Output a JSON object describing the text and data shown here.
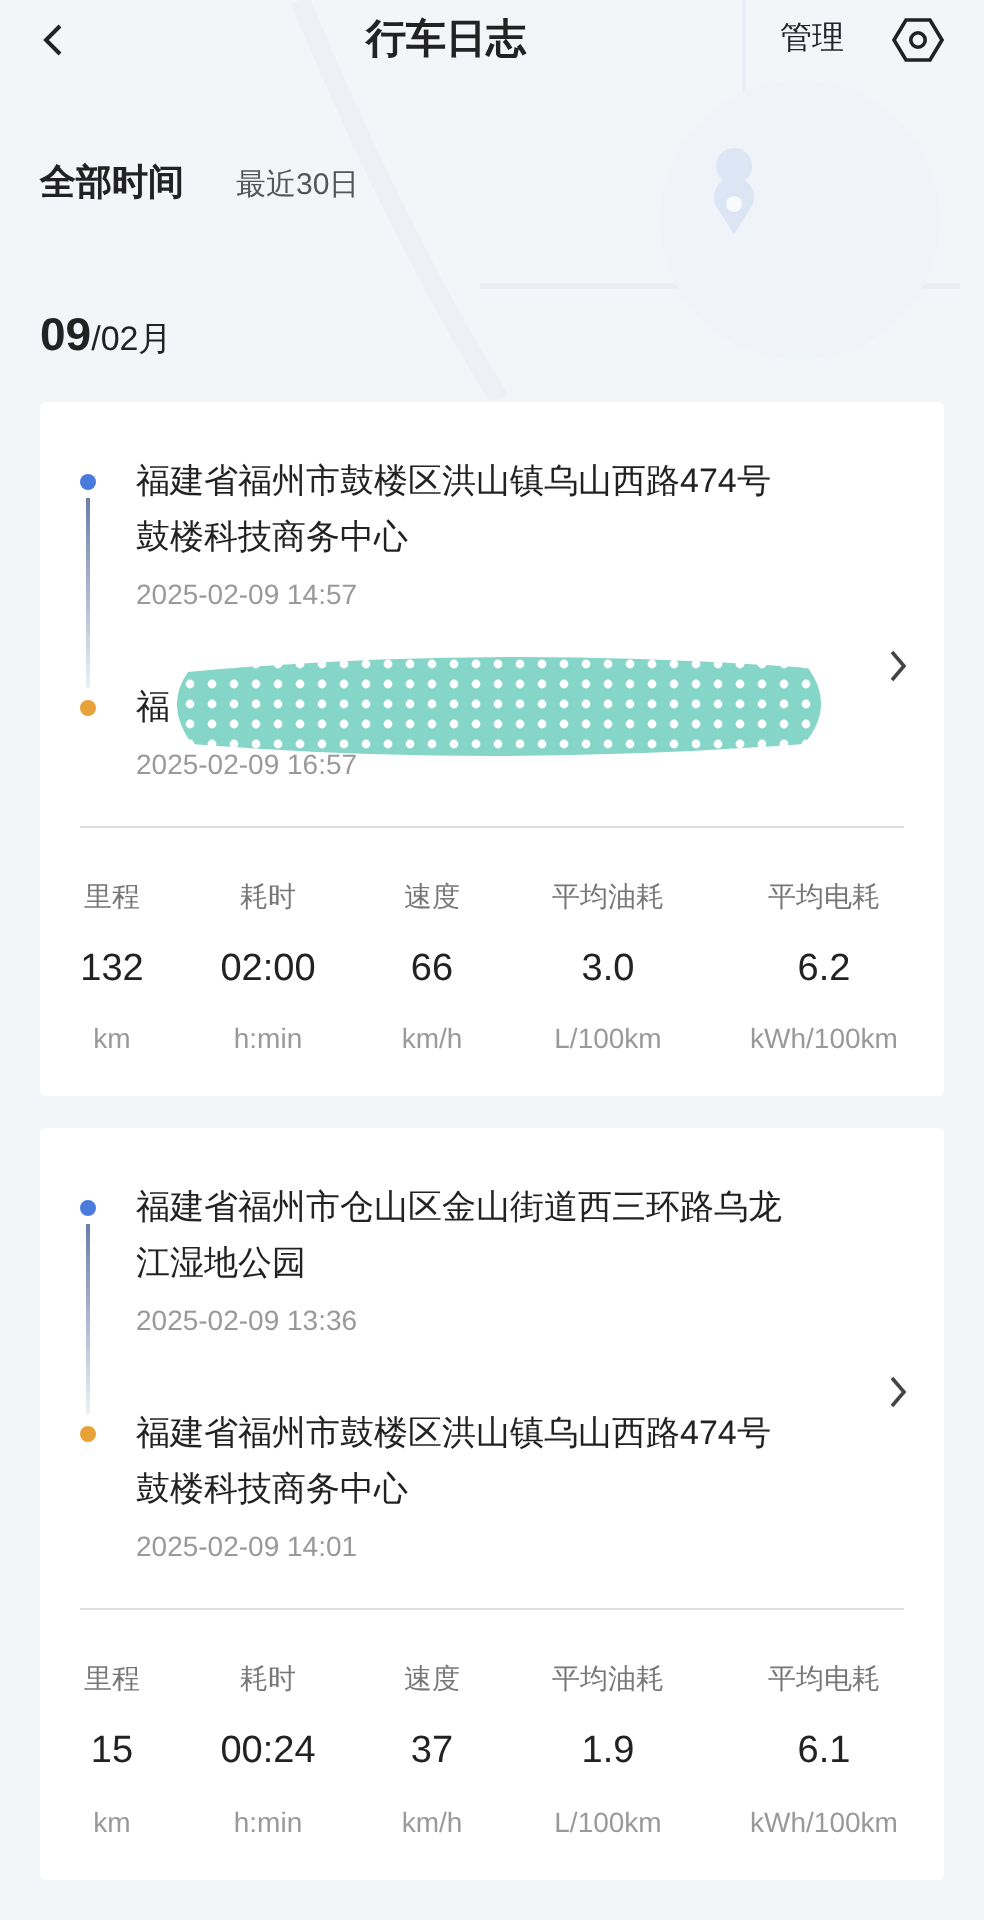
{
  "header": {
    "title": "行车日志",
    "action": "管理"
  },
  "filters": [
    {
      "label": "全部时间",
      "selected": true
    },
    {
      "label": "最近30日",
      "selected": false
    }
  ],
  "date_heading": {
    "day": "09",
    "month": "/02月"
  },
  "trips": [
    {
      "start": {
        "address": "福建省福州市鼓楼区洪山镇乌山西路474号鼓楼科技商务中心",
        "time": "2025-02-09 14:57"
      },
      "end": {
        "address": "福",
        "time": "2025-02-09 16:57",
        "redacted": true
      },
      "stats": [
        {
          "label": "里程",
          "value": "132",
          "unit": "km"
        },
        {
          "label": "耗时",
          "value": "02:00",
          "unit": "h:min"
        },
        {
          "label": "速度",
          "value": "66",
          "unit": "km/h"
        },
        {
          "label": "平均油耗",
          "value": "3.0",
          "unit": "L/100km"
        },
        {
          "label": "平均电耗",
          "value": "6.2",
          "unit": "kWh/100km"
        }
      ]
    },
    {
      "start": {
        "address": "福建省福州市仓山区金山街道西三环路乌龙江湿地公园",
        "time": "2025-02-09 13:36"
      },
      "end": {
        "address": "福建省福州市鼓楼区洪山镇乌山西路474号鼓楼科技商务中心",
        "time": "2025-02-09 14:01",
        "redacted": false
      },
      "stats": [
        {
          "label": "里程",
          "value": "15",
          "unit": "km"
        },
        {
          "label": "耗时",
          "value": "00:24",
          "unit": "h:min"
        },
        {
          "label": "速度",
          "value": "37",
          "unit": "km/h"
        },
        {
          "label": "平均油耗",
          "value": "1.9",
          "unit": "L/100km"
        },
        {
          "label": "平均电耗",
          "value": "6.1",
          "unit": "kWh/100km"
        }
      ]
    }
  ]
}
